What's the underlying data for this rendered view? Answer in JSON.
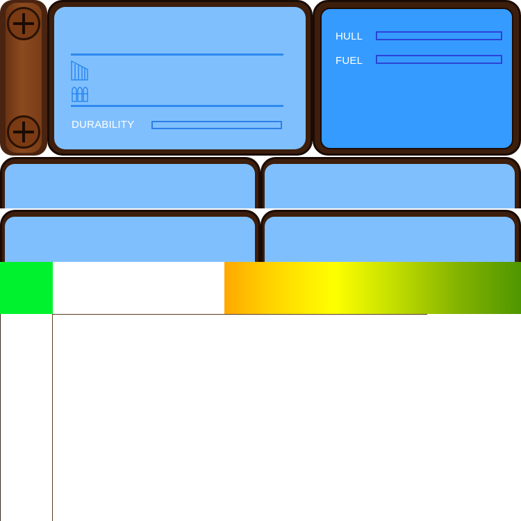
{
  "durability_panel": {
    "durability_label": "DURABILITY",
    "icons": [
      "signal-bars-icon",
      "ammo-icon"
    ]
  },
  "status_panel": {
    "hull_label": "HULL",
    "fuel_label": "FUEL"
  },
  "colors": {
    "frame": "#3d1e0c",
    "panel_light": "#80bffe",
    "panel_dark": "#359bff",
    "bar_outline": "#2b7fe6",
    "green_swatch": "#00f22f",
    "gradient_start": "#ffa800",
    "gradient_mid": "#ffff00",
    "gradient_end": "#4e9600"
  }
}
